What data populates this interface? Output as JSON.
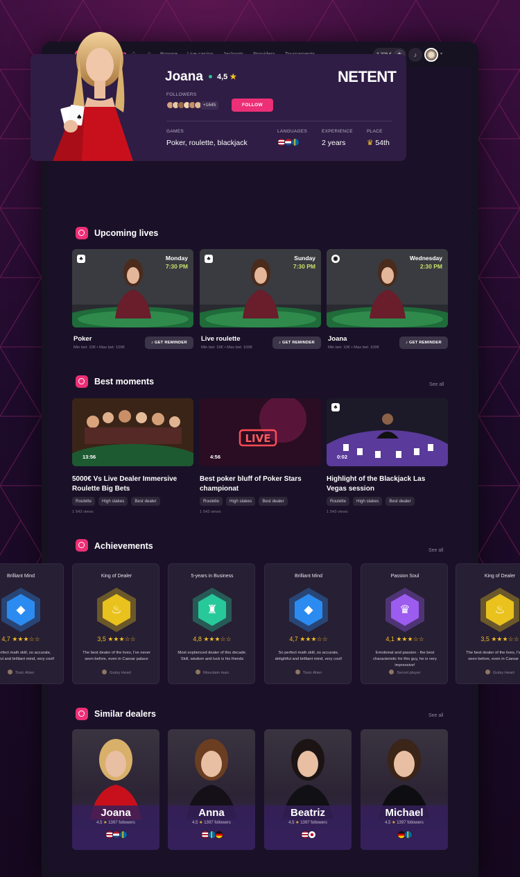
{
  "app": {
    "logo_text": "andyloop",
    "accent": "#ec2f76"
  },
  "nav": {
    "links": [
      "Browse",
      "Live casino",
      "Jackpots",
      "Providers",
      "Tournaments"
    ],
    "balance": "3 208 €"
  },
  "dealer": {
    "name": "Joana",
    "rating": "4,5",
    "provider_logo": "NETENT",
    "followers_label": "FOLLOWERS",
    "followers_count": "+1645",
    "follow_label": "FOLLOW",
    "games_label": "GAMES",
    "games_value": "Poker, roulette, blackjack",
    "languages_label": "LANGUAGES",
    "languages": [
      "usa",
      "netherlands",
      "sweden"
    ],
    "experience_label": "EXPERIENCE",
    "experience_value": "2 years",
    "place_label": "PLACE",
    "place_value": "54th"
  },
  "upcoming": {
    "title": "Upcoming lives",
    "reminder_label": "GET REMINDER",
    "items": [
      {
        "day": "Monday",
        "time": "7:30 PM",
        "title": "Poker",
        "meta": "Min bet: 10€  •  Max bet: 100€",
        "icon": "cards-icon"
      },
      {
        "day": "Sunday",
        "time": "7:30 PM",
        "title": "Live roulette",
        "meta": "Min bet: 10€  •  Max bet: 100€",
        "icon": "cards-icon"
      },
      {
        "day": "Wednesday",
        "time": "2:30 PM",
        "title": "Joana",
        "meta": "Min bet: 10€  •  Max bet: 100€",
        "icon": "roulette-icon"
      }
    ]
  },
  "moments": {
    "title": "Best moments",
    "see_all": "See all",
    "items": [
      {
        "duration": "13:56",
        "title": "5000€ Vs Live Dealer Immersive Roulette Big Bets",
        "tags": [
          "Roulette",
          "High stakes",
          "Best dealer"
        ],
        "views": "1 543 views"
      },
      {
        "duration": "4:56",
        "title": "Best poker bluff of Poker Stars championat",
        "tags": [
          "Roulette",
          "High stakes",
          "Best dealer"
        ],
        "views": "1 543 views"
      },
      {
        "duration": "0:02",
        "title": "Highlight of the Blackjack Las Vegas session",
        "tags": [
          "Roulette",
          "High stakes",
          "Best dealer"
        ],
        "views": "1 543 views"
      }
    ]
  },
  "achievements": {
    "title": "Achievements",
    "see_all": "See all",
    "items": [
      {
        "name": "Brilliant Mind",
        "rating": "4,7",
        "quote": "So perfect math skill, so accurate, delightful and brilliant mind, very cool!",
        "author": "Toxic Alien",
        "color": "#2c8bf0",
        "glyph": "gem"
      },
      {
        "name": "King of Dealer",
        "rating": "3,5",
        "quote": "The best dealer of the lives, I've never seen before, even in Caesar palace",
        "author": "Gutsy Heart",
        "color": "#e9c21d",
        "glyph": "flame"
      },
      {
        "name": "5-years in Business",
        "rating": "4,8",
        "quote": "Most exptienced dealer of this decade. Skill, wisdom and luck is his friends",
        "author": "Mountain man",
        "color": "#27c99a",
        "glyph": "top-hat"
      },
      {
        "name": "Brilliant Mind",
        "rating": "4,7",
        "quote": "So perfect math skill, so accurate, delightful and brilliant mind, very cool!",
        "author": "Toxic Alien",
        "color": "#2c8bf0",
        "glyph": "gem"
      },
      {
        "name": "Passion Soul",
        "rating": "4,1",
        "quote": "Emotional and passion - the best characteristic for this guy, he is very impressive!",
        "author": "Secret player",
        "color": "#9c5cf0",
        "glyph": "crown"
      },
      {
        "name": "King of Dealer",
        "rating": "3,5",
        "quote": "The best dealer of the lives, I've never seen before, even in Caesar palace",
        "author": "Gutsy Heart",
        "color": "#e9c21d",
        "glyph": "flame"
      }
    ]
  },
  "similar": {
    "title": "Similar dealers",
    "see_all": "See all",
    "items": [
      {
        "name": "Joana",
        "rating": "4,5",
        "followers": "1397 followers",
        "flags": [
          "usa",
          "netherlands",
          "sweden"
        ]
      },
      {
        "name": "Anna",
        "rating": "4,5",
        "followers": "1397 followers",
        "flags": [
          "usa",
          "sweden",
          "germany"
        ]
      },
      {
        "name": "Beatriz",
        "rating": "4,5",
        "followers": "1397 followers",
        "flags": [
          "usa",
          "japan"
        ]
      },
      {
        "name": "Michael",
        "rating": "4,5",
        "followers": "1397 followers",
        "flags": [
          "germany",
          "sweden"
        ]
      }
    ]
  }
}
